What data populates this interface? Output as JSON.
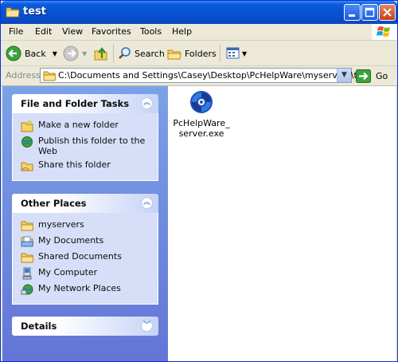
{
  "window": {
    "title": "test"
  },
  "menu": [
    "File",
    "Edit",
    "View",
    "Favorites",
    "Tools",
    "Help"
  ],
  "toolbar": {
    "back_label": "Back",
    "search_label": "Search",
    "folders_label": "Folders"
  },
  "address": {
    "label": "Address",
    "value": "C:\\Documents and Settings\\Casey\\Desktop\\PcHelpWare\\myservers\\test",
    "go_label": "Go"
  },
  "panels": {
    "file_tasks": {
      "title": "File and Folder Tasks",
      "items": [
        {
          "label": "Make a new folder",
          "icon": "new-folder-icon"
        },
        {
          "label": "Publish this folder to the Web",
          "icon": "publish-web-icon"
        },
        {
          "label": "Share this folder",
          "icon": "share-folder-icon"
        }
      ]
    },
    "other_places": {
      "title": "Other Places",
      "items": [
        {
          "label": "myservers",
          "icon": "folder-icon"
        },
        {
          "label": "My Documents",
          "icon": "my-documents-icon"
        },
        {
          "label": "Shared Documents",
          "icon": "shared-documents-icon"
        },
        {
          "label": "My Computer",
          "icon": "my-computer-icon"
        },
        {
          "label": "My Network Places",
          "icon": "network-places-icon"
        }
      ]
    },
    "details": {
      "title": "Details"
    }
  },
  "files": [
    {
      "name": "PcHelpWare_server.exe",
      "icon": "pchelpware-app-icon"
    }
  ],
  "colors": {
    "titlebar": "#0a5bdc",
    "task_pane": "#7ba2e7",
    "panel_body": "#d6dff7"
  }
}
